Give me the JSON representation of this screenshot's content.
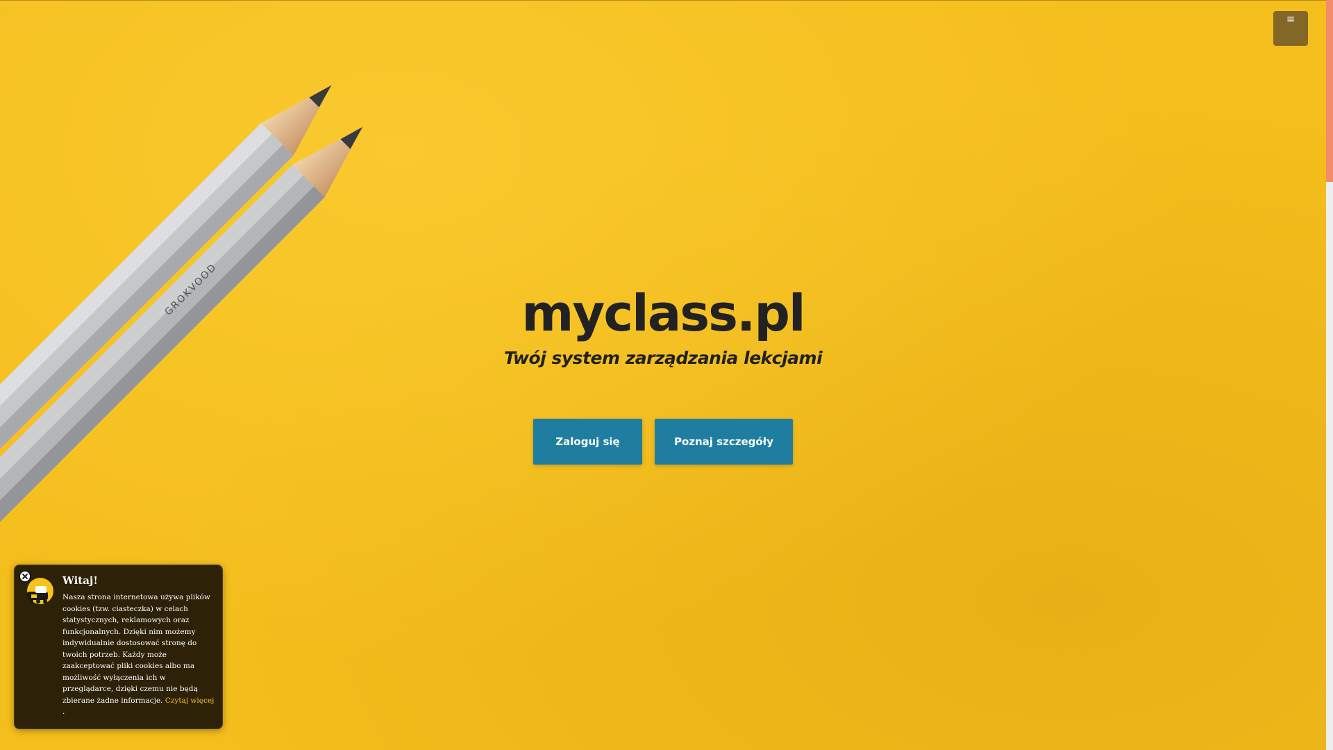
{
  "hero": {
    "title": "myclass.pl",
    "subtitle": "Twój system zarządzania lekcjami",
    "login_button": "Zaloguj się",
    "details_button": "Poznaj szczegóły"
  },
  "menu": {
    "toggle_glyph": "≡"
  },
  "pencil": {
    "brand_text": "GROKVOOD"
  },
  "cookie_notice": {
    "title": "Witaj!",
    "text": "Nasza strona internetowa używa plików cookies (tzw. ciasteczka) w celach statystycznych, reklamowych oraz funkcjonalnych. Dzięki nim możemy indywidualnie dostosować stronę do twoich potrzeb. Każdy może zaakceptować pliki cookies albo ma możliwość wyłączenia ich w przeglądarce, dzięki czemu nie będą zbierane żadne informacje.",
    "read_more_link": "Czytaj więcej",
    "trailing_period": "."
  },
  "colors": {
    "background": "#f4be1c",
    "button": "#1f7ea0",
    "cookie_background": "#2d2208",
    "cookie_link": "#f6c21c",
    "scroll_thumb": "#f28b6a",
    "menu_toggle": "#785f28"
  }
}
